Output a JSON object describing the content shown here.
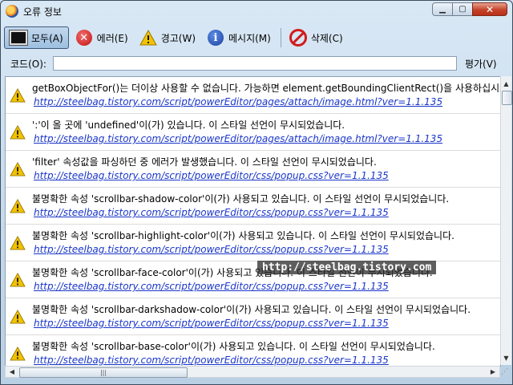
{
  "window": {
    "title": "오류 정보"
  },
  "toolbar": {
    "all_label": "모두(A)",
    "errors_label": "에러(E)",
    "warnings_label": "경고(W)",
    "messages_label": "메시지(M)",
    "clear_label": "삭제(C)"
  },
  "codebar": {
    "label": "코드(O):",
    "value": "",
    "eval_label": "평가(V)"
  },
  "messages": [
    {
      "text": "getBoxObjectFor()는 더이상 사용할 수 없습니다. 가능하면 element.getBoundingClientRect()을 사용하십시오.",
      "source": "http://steelbag.tistory.com/script/powerEditor/pages/attach/image.html?ver=1.1.135"
    },
    {
      "text": "':'이 올 곳에 'undefined'이(가) 있습니다.  이 스타일 선언이 무시되었습니다.",
      "source": "http://steelbag.tistory.com/script/powerEditor/pages/attach/image.html?ver=1.1.135"
    },
    {
      "text": "'filter' 속성값을  파싱하던 중 에러가 발생했습니다.  이 스타일 선언이 무시되었습니다.",
      "source": "http://steelbag.tistory.com/script/powerEditor/css/popup.css?ver=1.1.135"
    },
    {
      "text": "불명확한 속성 'scrollbar-shadow-color'이(가) 사용되고 있습니다.  이 스타일 선언이 무시되었습니다.",
      "source": "http://steelbag.tistory.com/script/powerEditor/css/popup.css?ver=1.1.135"
    },
    {
      "text": "불명확한 속성 'scrollbar-highlight-color'이(가) 사용되고 있습니다.  이 스타일 선언이 무시되었습니다.",
      "source": "http://steelbag.tistory.com/script/powerEditor/css/popup.css?ver=1.1.135"
    },
    {
      "text": "불명확한 속성 'scrollbar-face-color'이(가) 사용되고 있습니다.  이 스타일 선언이 무시되었습니다.",
      "source": "http://steelbag.tistory.com/script/powerEditor/css/popup.css?ver=1.1.135"
    },
    {
      "text": "불명확한 속성 'scrollbar-darkshadow-color'이(가) 사용되고 있습니다.  이 스타일 선언이 무시되었습니다.",
      "source": "http://steelbag.tistory.com/script/powerEditor/css/popup.css?ver=1.1.135"
    },
    {
      "text": "불명확한 속성 'scrollbar-base-color'이(가) 사용되고 있습니다.  이 스타일 선언이 무시되었습니다.",
      "source": "http://steelbag.tistory.com/script/powerEditor/css/popup.css?ver=1.1.135"
    }
  ],
  "watermark": "http://steelbag.tistory.com",
  "icons": {
    "message_icon": "warning-icon"
  },
  "colors": {
    "link": "#1a36c9",
    "warning": "#f2c200",
    "error": "#c21010",
    "info": "#1a3f9e"
  }
}
